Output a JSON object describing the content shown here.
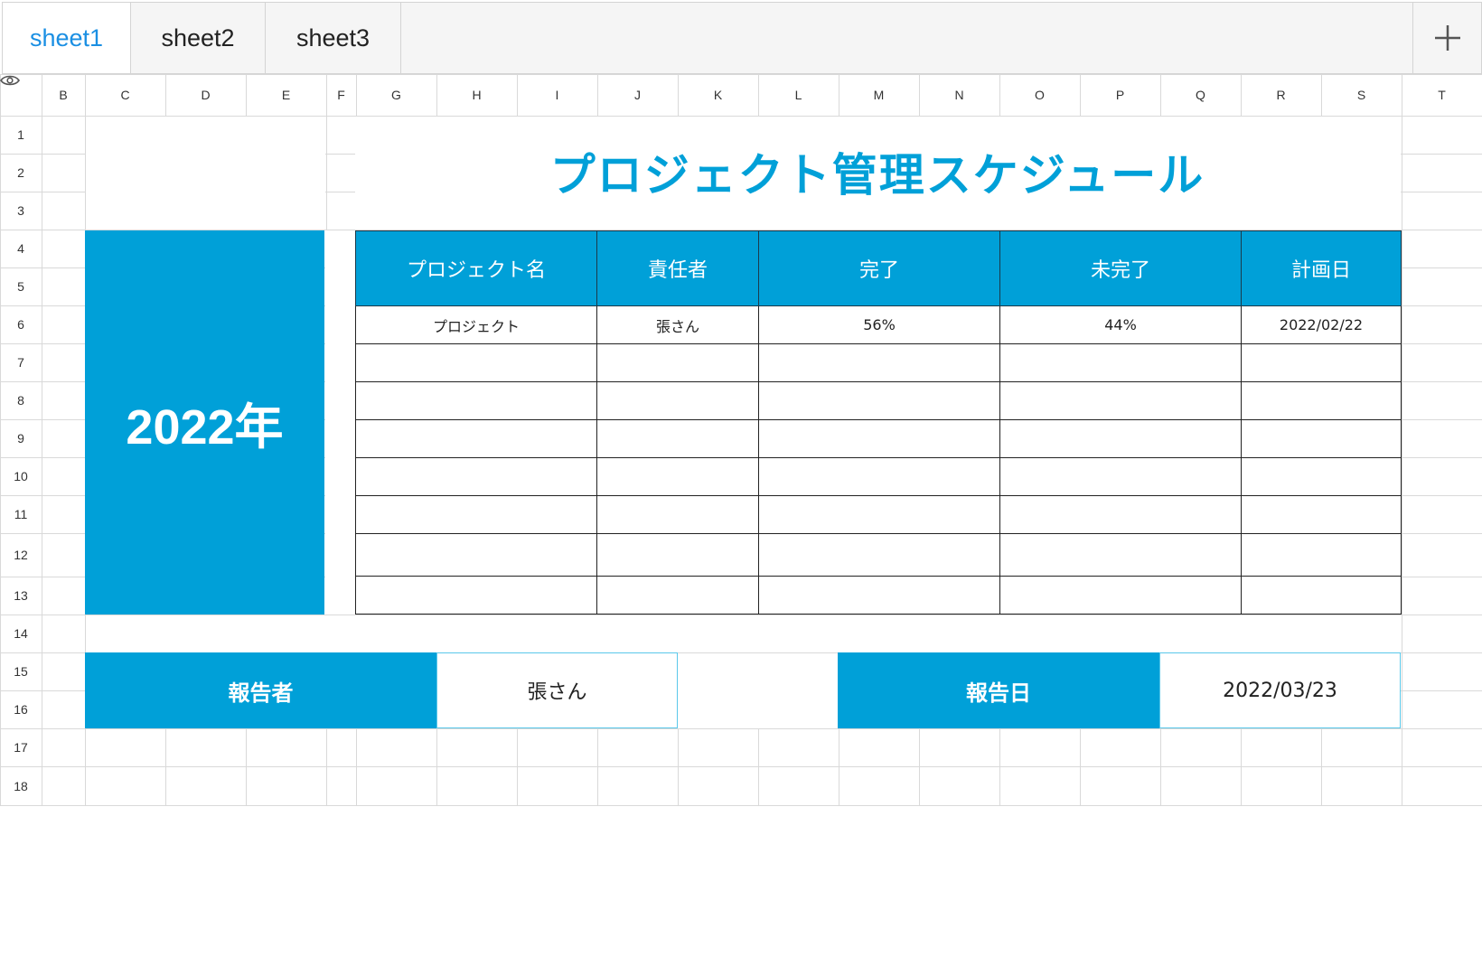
{
  "tabs": [
    {
      "label": "sheet1",
      "active": true
    },
    {
      "label": "sheet2",
      "active": false
    },
    {
      "label": "sheet3",
      "active": false
    }
  ],
  "columns": [
    "B",
    "C",
    "D",
    "E",
    "F",
    "G",
    "H",
    "I",
    "J",
    "K",
    "L",
    "M",
    "N",
    "O",
    "P",
    "Q",
    "R",
    "S",
    "T"
  ],
  "rows": [
    "1",
    "2",
    "3",
    "4",
    "5",
    "6",
    "7",
    "8",
    "9",
    "10",
    "11",
    "12",
    "13",
    "14",
    "15",
    "16",
    "17",
    "18"
  ],
  "title": "プロジェクト管理スケジュール",
  "year": "2022年",
  "table": {
    "headers": [
      "プロジェクト名",
      "責任者",
      "完了",
      "未完了",
      "計画日"
    ],
    "rows": [
      [
        "プロジェクト",
        "張さん",
        "56%",
        "44%",
        "2022/02/22"
      ]
    ]
  },
  "report": {
    "reporter_label": "報告者",
    "reporter_value": "張さん",
    "date_label": "報告日",
    "date_value": "2022/03/23"
  },
  "colors": {
    "accent": "#00a0d8",
    "active_tab": "#1a8fe3",
    "grid": "#d9d9d9"
  }
}
